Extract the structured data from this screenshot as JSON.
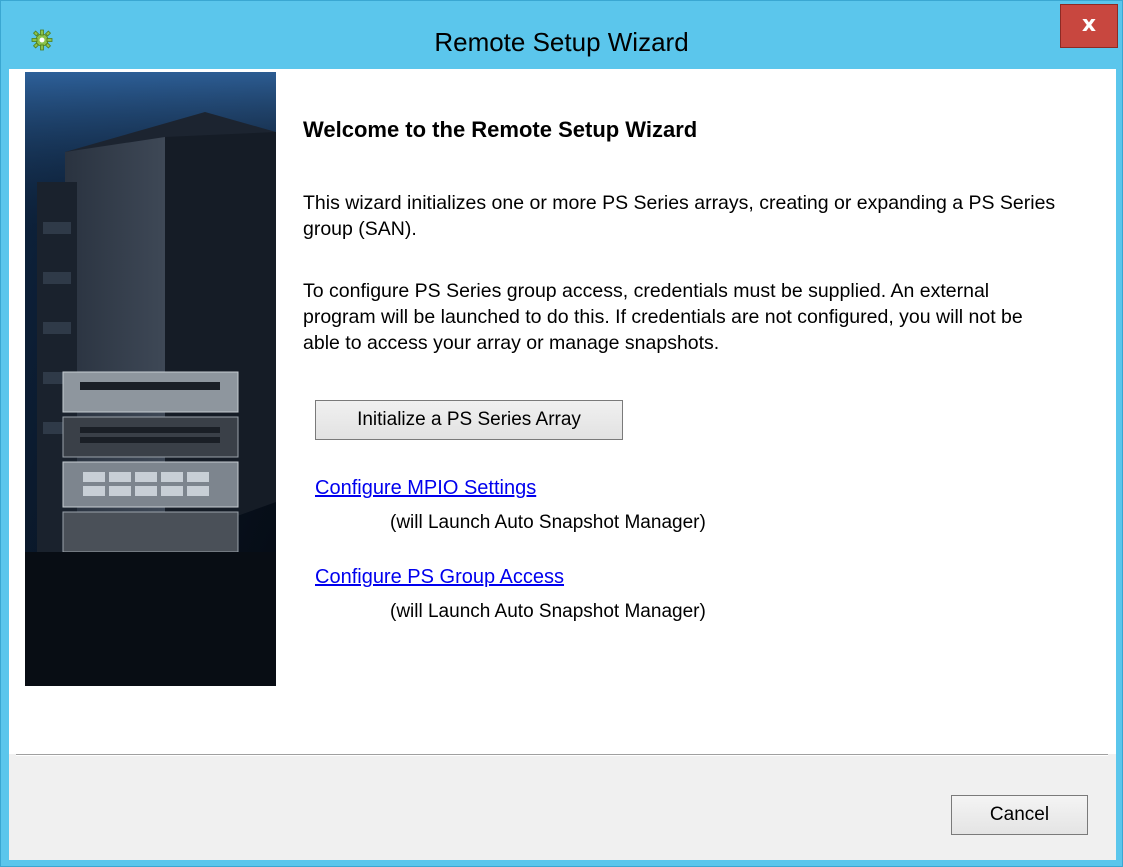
{
  "window": {
    "title": "Remote Setup Wizard",
    "close_label": "x",
    "app_icon": "gear-icon",
    "accent_color": "#5bc6ec",
    "close_color": "#c8473f"
  },
  "side_image": {
    "description_icon": "server-rack-image"
  },
  "main": {
    "heading": "Welcome to the Remote Setup Wizard",
    "paragraph1": "This wizard initializes one or more PS Series arrays, creating or expanding a PS Series group (SAN).",
    "paragraph2": "To configure PS Series group access, credentials must be supplied. An external program will be launched to do this. If credentials are not configured, you will not be able to access your array or manage snapshots.",
    "initialize_button": "Initialize a PS Series Array",
    "links": [
      {
        "label": "Configure MPIO Settings",
        "note": "(will Launch Auto Snapshot Manager)"
      },
      {
        "label": "Configure PS Group Access",
        "note": "(will Launch Auto Snapshot Manager)"
      }
    ],
    "link_color": "#0000ee"
  },
  "footer": {
    "cancel_label": "Cancel"
  }
}
